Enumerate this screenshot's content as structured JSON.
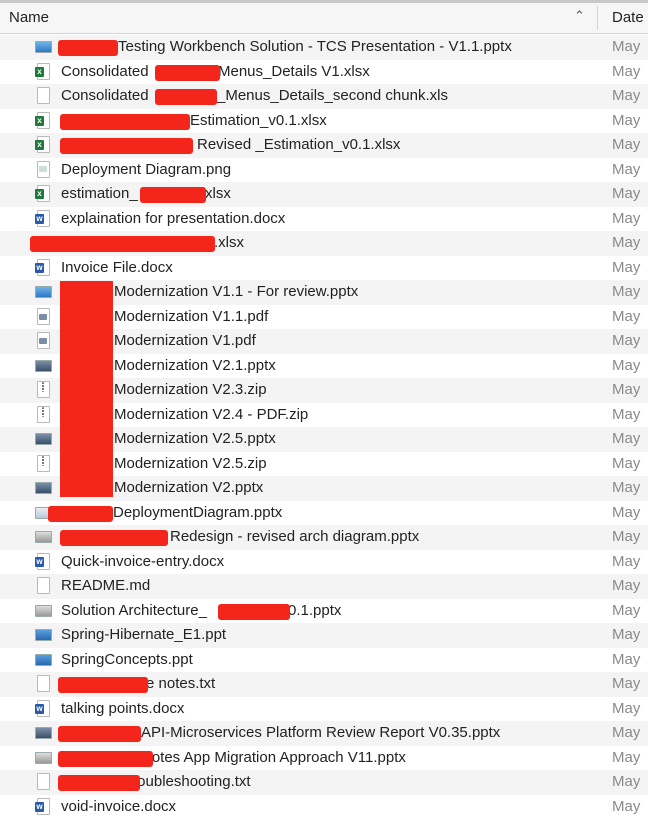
{
  "header": {
    "name_label": "Name",
    "date_label": "Date",
    "sort_icon": "chevron-up-icon"
  },
  "colors": {
    "redaction": "#f4261b",
    "row_alt": "#f4f4f4"
  },
  "files": [
    {
      "icon": "pptx",
      "before": "",
      "after": "Testing Workbench Solution - TCS Presentation - V1.1.pptx",
      "date": "May"
    },
    {
      "icon": "xlsx",
      "before": "Consolidated",
      "after": "Menus_Details V1.xlsx",
      "date": "May"
    },
    {
      "icon": "generic",
      "before": "Consolidated",
      "after": "_Menus_Details_second chunk.xls",
      "date": "May"
    },
    {
      "icon": "xlsx",
      "before": "",
      "after": " Estimation_v0.1.xlsx",
      "date": "May"
    },
    {
      "icon": "xlsx",
      "before": "",
      "after": "Revised _Estimation_v0.1.xlsx",
      "date": "May"
    },
    {
      "icon": "png",
      "before": "Deployment Diagram.png",
      "after": "",
      "date": "May"
    },
    {
      "icon": "xlsx",
      "before": "estimation_",
      "after": "xlsx",
      "date": "May"
    },
    {
      "icon": "docx",
      "before": "explaination for presentation.docx",
      "after": "",
      "date": "May"
    },
    {
      "icon": "none",
      "before": "",
      "after": ".xlsx",
      "date": "May"
    },
    {
      "icon": "docx",
      "before": "Invoice File.docx",
      "after": "",
      "date": "May"
    },
    {
      "icon": "pptx",
      "before": "",
      "after": "Modernization V1.1 - For review.pptx",
      "date": "May"
    },
    {
      "icon": "pdf",
      "before": "",
      "after": "Modernization V1.1.pdf",
      "date": "May"
    },
    {
      "icon": "pdf",
      "before": "",
      "after": "Modernization V1.pdf",
      "date": "May"
    },
    {
      "icon": "pptx-dark",
      "before": "",
      "after": "Modernization V2.1.pptx",
      "date": "May"
    },
    {
      "icon": "zip",
      "before": "",
      "after": "Modernization V2.3.zip",
      "date": "May"
    },
    {
      "icon": "zip",
      "before": "",
      "after": "Modernization V2.4 - PDF.zip",
      "date": "May"
    },
    {
      "icon": "pptx-dark",
      "before": "",
      "after": "Modernization V2.5.pptx",
      "date": "May"
    },
    {
      "icon": "zip",
      "before": "",
      "after": "Modernization V2.5.zip",
      "date": "May"
    },
    {
      "icon": "pptx-dark",
      "before": "",
      "after": "Modernization V2.pptx",
      "date": "May"
    },
    {
      "icon": "pptx-light",
      "before": "",
      "after": "DeploymentDiagram.pptx",
      "date": "May"
    },
    {
      "icon": "pptx-gray",
      "before": "",
      "after": "Redesign - revised arch diagram.pptx",
      "date": "May"
    },
    {
      "icon": "docx",
      "before": "Quick-invoice-entry.docx",
      "after": "",
      "date": "May"
    },
    {
      "icon": "generic",
      "before": "README.md",
      "after": "",
      "date": "May"
    },
    {
      "icon": "pptx-gray",
      "before": "Solution Architecture_",
      "after": "0.1.pptx",
      "date": "May"
    },
    {
      "icon": "ppt",
      "before": "Spring-Hibernate_E1.ppt",
      "after": "",
      "date": "May"
    },
    {
      "icon": "ppt",
      "before": "SpringConcepts.ppt",
      "after": "",
      "date": "May"
    },
    {
      "icon": "txt",
      "before": "",
      "after": "e notes.txt",
      "date": "May"
    },
    {
      "icon": "docx",
      "before": "talking points.docx",
      "after": "",
      "date": "May"
    },
    {
      "icon": "pptx-dark",
      "before": "",
      "after": "API-Microservices Platform Review Report V0.35.pptx",
      "date": "May"
    },
    {
      "icon": "pptx-gray",
      "before": "",
      "after": "Notes App Migration Approach V11.pptx",
      "date": "May"
    },
    {
      "icon": "txt",
      "before": "",
      "after": "troubleshooting.txt",
      "date": "May"
    },
    {
      "icon": "docx",
      "before": "void-invoice.docx",
      "after": "",
      "date": "May"
    }
  ]
}
